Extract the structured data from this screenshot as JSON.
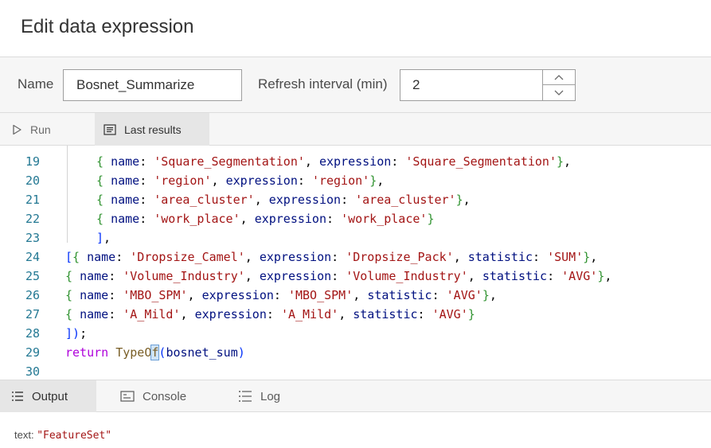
{
  "dialog": {
    "title": "Edit data expression"
  },
  "fields": {
    "name_label": "Name",
    "name_value": "Bosnet_Summarize",
    "refresh_label": "Refresh interval (min)",
    "refresh_value": "2"
  },
  "toolbar": {
    "run_label": "Run",
    "last_results_label": "Last results"
  },
  "editor": {
    "lines": [
      {
        "n": "19",
        "t": "{ name: 'Square_Segmentation', expression: 'Square_Segmentation'},"
      },
      {
        "n": "20",
        "t": "{ name: 'region', expression: 'region'},"
      },
      {
        "n": "21",
        "t": "{ name: 'area_cluster', expression: 'area_cluster'},"
      },
      {
        "n": "22",
        "t": "{ name: 'work_place', expression: 'work_place'}"
      },
      {
        "n": "23",
        "t": "],"
      },
      {
        "n": "24",
        "t": "[{ name: 'Dropsize_Camel', expression: 'Dropsize_Pack', statistic: 'SUM'},"
      },
      {
        "n": "25",
        "t": "{ name: 'Volume_Industry', expression: 'Volume_Industry', statistic: 'AVG'},"
      },
      {
        "n": "26",
        "t": "{ name: 'MBO_SPM', expression: 'MBO_SPM', statistic: 'AVG'},"
      },
      {
        "n": "27",
        "t": "{ name: 'A_Mild', expression: 'A_Mild', statistic: 'AVG'}"
      },
      {
        "n": "28",
        "t": "]);"
      },
      {
        "n": "29",
        "t": "return TypeOf(bosnet_sum)"
      },
      {
        "n": "30",
        "t": ""
      }
    ]
  },
  "output_tabs": {
    "output": "Output",
    "console": "Console",
    "log": "Log"
  },
  "output": {
    "key": "text: ",
    "value": "\"FeatureSet\""
  },
  "colors": {
    "keyword": "#af00db",
    "string": "#a31515",
    "line_number": "#237893",
    "property": "#001080"
  }
}
